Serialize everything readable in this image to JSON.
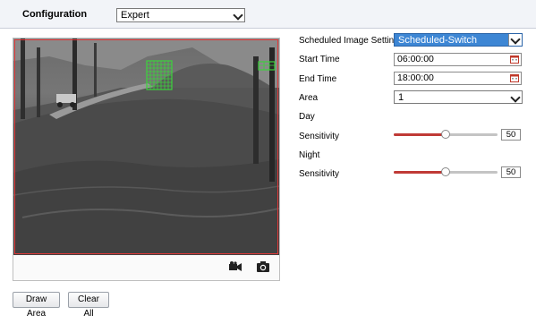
{
  "header": {
    "configuration_label": "Configuration",
    "mode_value": "Expert"
  },
  "viewer": {
    "record_icon": "video-camera-icon",
    "snapshot_icon": "camera-icon"
  },
  "actions": {
    "draw_area": "Draw Area",
    "clear_all": "Clear All"
  },
  "settings": {
    "scheduled_label": "Scheduled Image Settings",
    "scheduled_value": "Scheduled-Switch",
    "start_time_label": "Start Time",
    "start_time_value": "06:00:00",
    "end_time_label": "End Time",
    "end_time_value": "18:00:00",
    "area_label": "Area",
    "area_value": "1",
    "day_label": "Day",
    "day_sensitivity_label": "Sensitivity",
    "day_sensitivity_value": "50",
    "night_label": "Night",
    "night_sensitivity_label": "Sensitivity",
    "night_sensitivity_value": "50"
  },
  "colors": {
    "slider_fill": "#c03a36",
    "scheduled_select_bg": "#3d86d4",
    "area_outline": "#e23a3a",
    "motion_grid": "#3cd23c"
  }
}
